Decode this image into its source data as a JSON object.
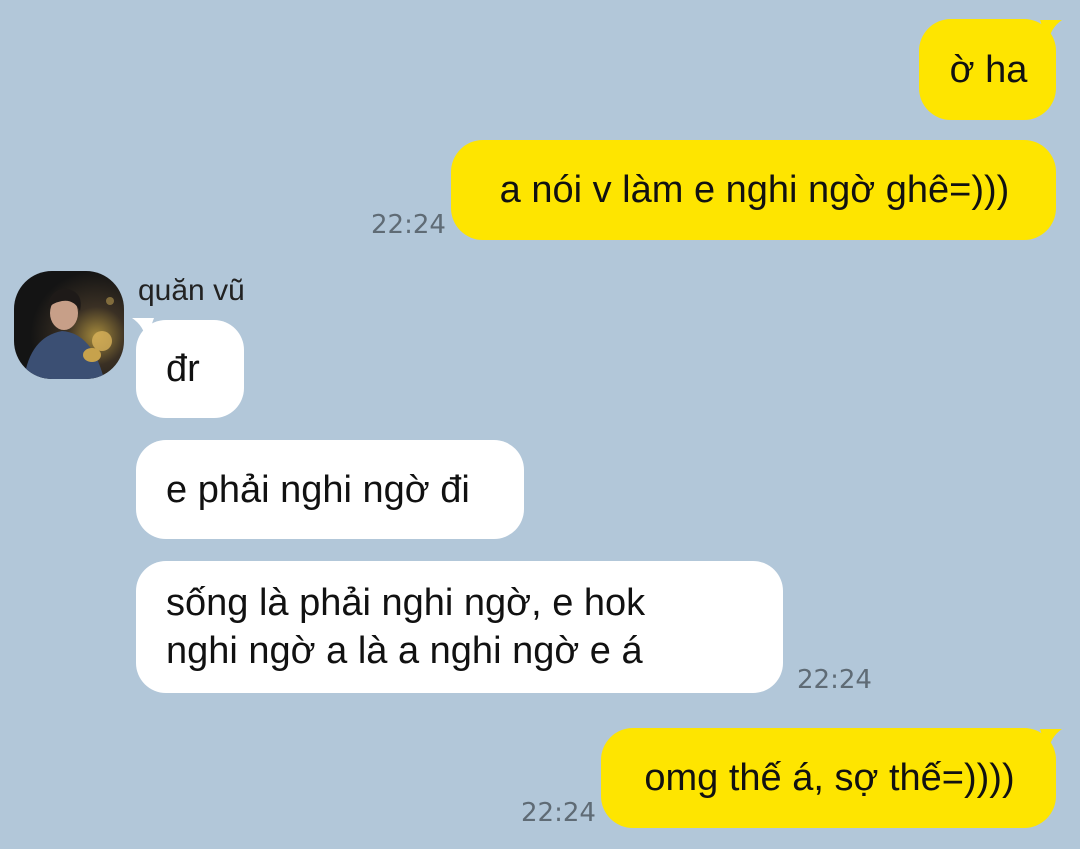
{
  "messages": [
    {
      "id": "m1",
      "side": "me",
      "text": "ờ ha",
      "time": ""
    },
    {
      "id": "m2",
      "side": "me",
      "text": "a nói v làm e nghi ngờ ghê=)))",
      "time": "22:24"
    },
    {
      "id": "m3",
      "side": "them",
      "text": "đr",
      "time": ""
    },
    {
      "id": "m4",
      "side": "them",
      "text": "e phải nghi ngờ đi",
      "time": ""
    },
    {
      "id": "m5",
      "side": "them",
      "line1": "sống là phải nghi ngờ, e hok",
      "line2": "nghi ngờ a là a nghi ngờ e á",
      "time": "22:24"
    },
    {
      "id": "m6",
      "side": "me",
      "text": "omg thế á, sợ thế=))))",
      "time": "22:24"
    }
  ],
  "contact": {
    "name": "quăn vũ",
    "avatar_icon": "profile-photo"
  },
  "colors": {
    "background": "#b2c7d9",
    "my_bubble": "#fee500",
    "their_bubble": "#ffffff",
    "timestamp": "#5f6b75"
  }
}
